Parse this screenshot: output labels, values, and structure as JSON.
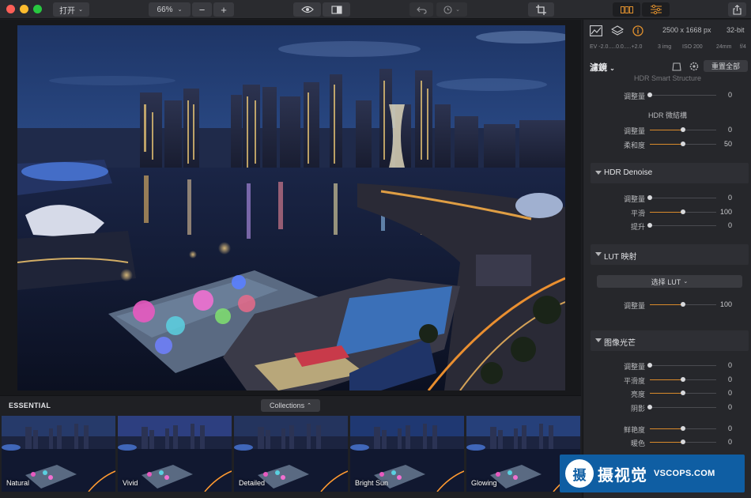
{
  "toolbar": {
    "open_label": "打开",
    "zoom_value": "66%",
    "zoom_out": "−",
    "zoom_in": "+"
  },
  "image_info": {
    "dimensions": "2500 x 1668 px",
    "bit_depth": "32-bit",
    "exif_ev": "EV -2.0.....0.0.....+2.0",
    "exif_images": "3 img",
    "exif_iso": "ISO 200",
    "exif_focal": "24mm",
    "exif_aperture": "f/4"
  },
  "panel": {
    "filters_title": "濾鏡",
    "reset_all": "重置全部",
    "partial_heading": "HDR Smart Structure",
    "partial_slider": {
      "label": "调整量",
      "value": "0",
      "level": 0.0
    },
    "micro_title": "HDR 微結構",
    "micro_sliders": [
      {
        "label": "调整量",
        "value": "0",
        "level": 0.5
      },
      {
        "label": "柔和度",
        "value": "50",
        "level": 0.5
      }
    ],
    "denoise": {
      "title": "HDR Denoise",
      "sliders": [
        {
          "label": "调整量",
          "value": "0",
          "level": 0.0
        },
        {
          "label": "平滑",
          "value": "100",
          "level": 0.5
        },
        {
          "label": "提升",
          "value": "0",
          "level": 0.0
        }
      ]
    },
    "lut": {
      "title": "LUT 映射",
      "select": "选择 LUT",
      "sliders": [
        {
          "label": "调整量",
          "value": "100",
          "level": 0.5
        }
      ]
    },
    "glow": {
      "title": "图像光芒",
      "sliders": [
        {
          "label": "调整量",
          "value": "0",
          "level": 0.0
        },
        {
          "label": "平滑度",
          "value": "0",
          "level": 0.5
        },
        {
          "label": "亮度",
          "value": "0",
          "level": 0.5
        },
        {
          "label": "阴影",
          "value": "0",
          "level": 0.0
        },
        {
          "label": "鲜艳度",
          "value": "0",
          "level": 0.5
        },
        {
          "label": "暖色",
          "value": "0",
          "level": 0.5
        }
      ]
    }
  },
  "presets": {
    "category": "ESSENTIAL",
    "collections": "Collections",
    "items": [
      {
        "label": "Natural"
      },
      {
        "label": "Vivid"
      },
      {
        "label": "Detailed"
      },
      {
        "label": "Bright Sun"
      },
      {
        "label": "Glowing"
      }
    ]
  },
  "watermark": {
    "logo": "摄",
    "title": "摄视觉",
    "domain": "VSCOPS.COM"
  },
  "colors": {
    "accent": "#d98a2b",
    "traffic_close": "#fe5f57",
    "traffic_min": "#febc2e",
    "traffic_max": "#28c840",
    "watermark_bg": "#0f5ea3"
  }
}
